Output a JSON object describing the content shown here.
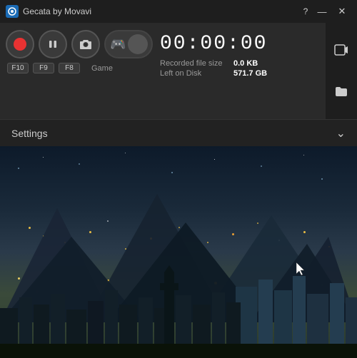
{
  "app": {
    "title": "Gecata by Movavi",
    "help_label": "?",
    "minimize_label": "—",
    "close_label": "✕"
  },
  "controls": {
    "timer": "00:00:00",
    "stats": {
      "recorded_label": "Recorded file size",
      "recorded_value": "0.0 KB",
      "disk_label": "Left on Disk",
      "disk_value": "571.7 GB"
    },
    "shortcuts": {
      "record": "F10",
      "pause": "F9",
      "screenshot": "F8",
      "game_label": "Game"
    }
  },
  "settings": {
    "label": "Settings",
    "chevron": "⌄"
  }
}
